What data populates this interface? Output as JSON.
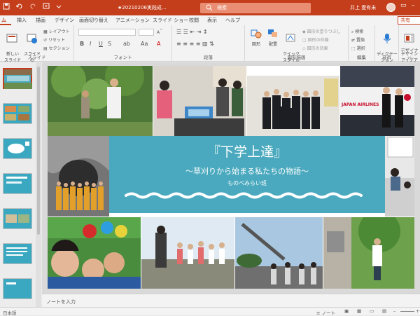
{
  "titlebar": {
    "doc_title": "★20210206実践成...",
    "search_label": "検索",
    "user_name": "井上 愛有未",
    "icons": [
      "save-icon",
      "undo-icon",
      "redo-icon",
      "start-from-beginning-icon",
      "customize-qat-icon"
    ]
  },
  "ribbon_tabs": [
    "ム",
    "挿入",
    "描画",
    "デザイン",
    "画面切り替え",
    "アニメーション",
    "スライド ショー",
    "校閲",
    "表示",
    "ヘルプ"
  ],
  "share_label": "共有",
  "ribbon": {
    "slides_group": {
      "label": "スライド",
      "new_slide": "新しい\nスライド",
      "reuse_slide": "スライドの\n再利用",
      "layout": "レイアウト",
      "reset": "リセット",
      "section": "セクション"
    },
    "font_group": {
      "label": "フォント",
      "bold": "B",
      "italic": "I",
      "underline": "U",
      "strike": "S",
      "font_color": "A"
    },
    "paragraph_group": {
      "label": "段落"
    },
    "drawing_group": {
      "label": "図形描画",
      "shapes": "図形",
      "arrange": "配置",
      "quick_styles": "クイック\nスタイル",
      "fill": "図形の塗りつぶし",
      "outline": "図形の枠線",
      "effects": "図形の効果"
    },
    "editing_group": {
      "label": "編集",
      "find": "検索",
      "replace": "置換",
      "select": "選択"
    },
    "voice_group": {
      "label": "音声",
      "dictate": "ディクテー\nション"
    },
    "designer_group": {
      "label": "デザイナー",
      "design_ideas": "デザイン\nアイデア"
    }
  },
  "slide": {
    "title": "『下学上達』",
    "subtitle": "～草刈りから始まる私たちの物語～",
    "team": "ものべみらい班",
    "airline_text": "JAPAN AIRLINES"
  },
  "notes_placeholder": "ノートを入力",
  "status": {
    "language": "日本語",
    "notes_btn": "ノート",
    "zoom_plus": "+"
  },
  "colors": {
    "accent": "#c43e1c",
    "banner": "#4aa9be"
  }
}
